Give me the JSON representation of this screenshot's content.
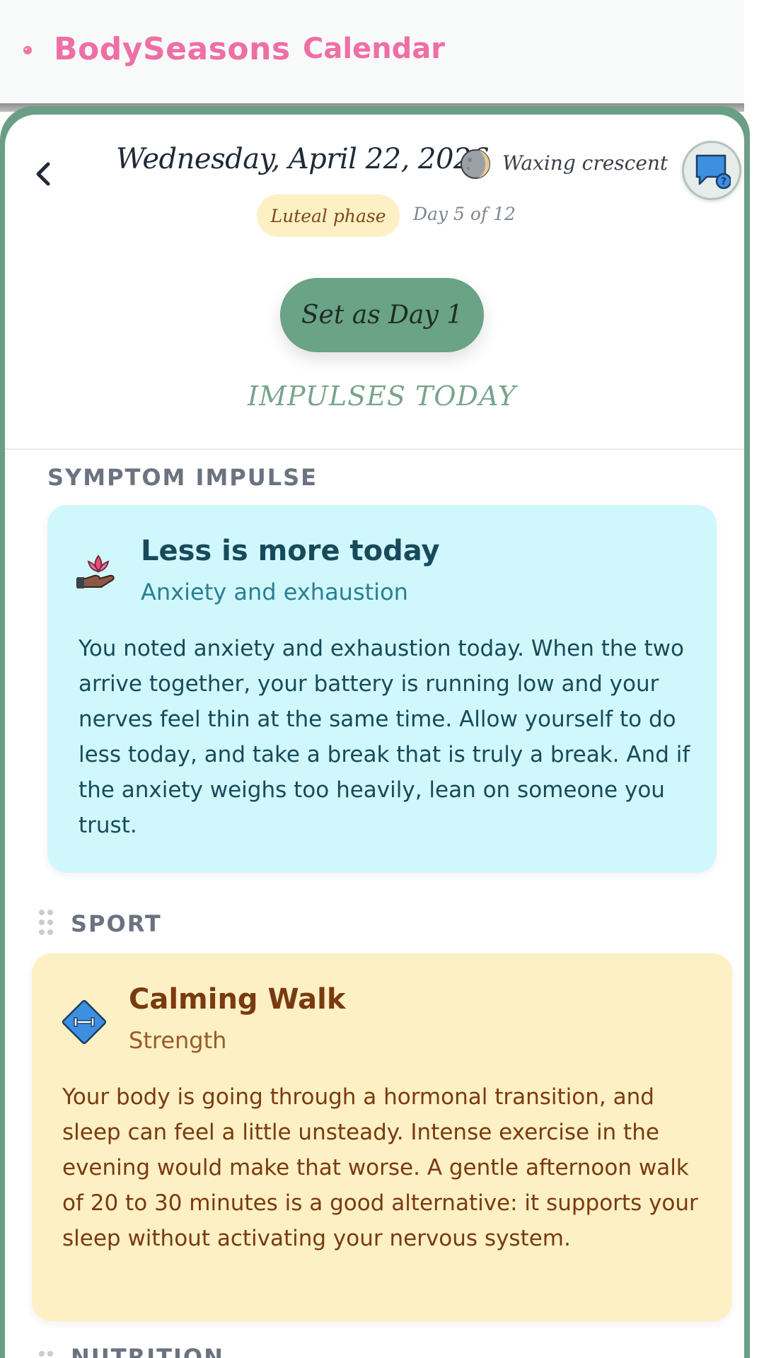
{
  "appbar": {
    "brand": "BodySeasons",
    "section": "Calendar"
  },
  "day": {
    "date": "Wednesday, April 22, 2026",
    "moon_phase": "Waxing crescent",
    "phase_label": "Luteal phase",
    "phase_day": "Day 5 of 12",
    "set_day1_label": "Set as Day 1",
    "impulses_title": "IMPULSES TODAY"
  },
  "sections": {
    "symptom": {
      "label": "SYMPTOM IMPULSE",
      "icon": "lotus-hand-icon",
      "title": "Less is more today",
      "subtitle": "Anxiety and exhaustion",
      "body": "You noted anxiety and exhaustion today. When the two arrive together, your battery is running low and your nerves feel thin at the same time. Allow yourself to do less today, and take a break that is truly a break. And if the anxiety weighs too heavily, lean on someone you trust."
    },
    "sport": {
      "label": "SPORT",
      "icon": "dumbbell-diamond-icon",
      "title": "Calming Walk",
      "subtitle": "Strength",
      "body": "Your body is going through a hormonal transition, and sleep can feel a little unsteady. Intense exercise in the evening would make that worse. A gentle afternoon walk of 20 to 30 minutes is a good alternative: it supports your sleep without activating your nervous system."
    },
    "nutrition": {
      "label": "NUTRITION"
    }
  },
  "colors": {
    "brand": "#ee6fa5",
    "accent_green": "#6aa386",
    "symptom_bg": "#d0f8fc",
    "sport_bg": "#fdf0c4"
  }
}
